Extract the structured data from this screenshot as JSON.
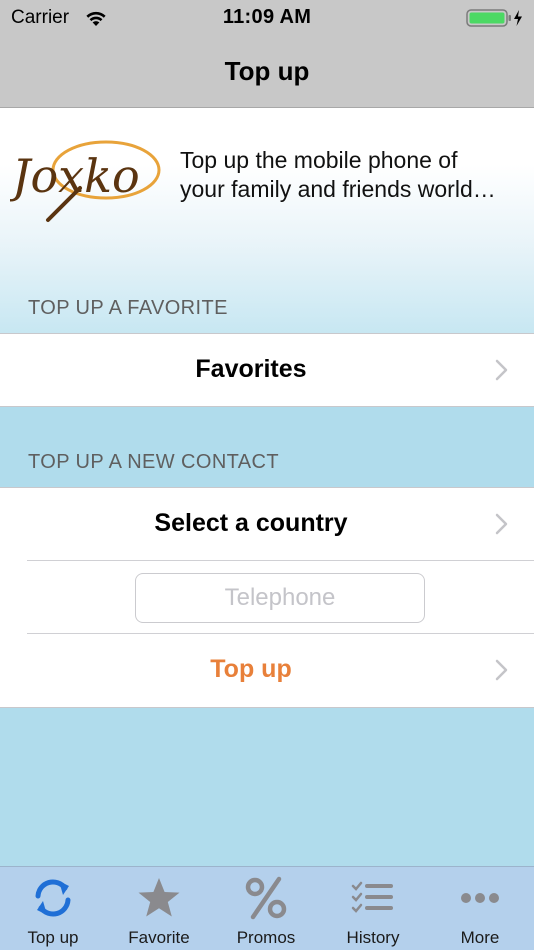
{
  "status_bar": {
    "carrier": "Carrier",
    "time": "11:09 AM",
    "battery_color": "#4cd964"
  },
  "nav": {
    "title": "Top up"
  },
  "banner": {
    "logo_text": "Joxko",
    "tagline_line1": "Top up the mobile phone of",
    "tagline_line2": "your family and friends world…"
  },
  "sections": {
    "favorite_header": "TOP UP A FAVORITE",
    "favorites_label": "Favorites",
    "new_contact_header": "TOP UP A NEW CONTACT",
    "country_label": "Select a country",
    "telephone_placeholder": "Telephone",
    "telephone_value": "",
    "topup_label": "Top up"
  },
  "accent_color": "#e8803a",
  "tabbar": {
    "tabs": [
      {
        "label": "Top up",
        "icon": "refresh-icon",
        "selected": true
      },
      {
        "label": "Favorite",
        "icon": "star-icon",
        "selected": false
      },
      {
        "label": "Promos",
        "icon": "percent-icon",
        "selected": false
      },
      {
        "label": "History",
        "icon": "list-icon",
        "selected": false
      },
      {
        "label": "More",
        "icon": "more-icon",
        "selected": false
      }
    ]
  }
}
